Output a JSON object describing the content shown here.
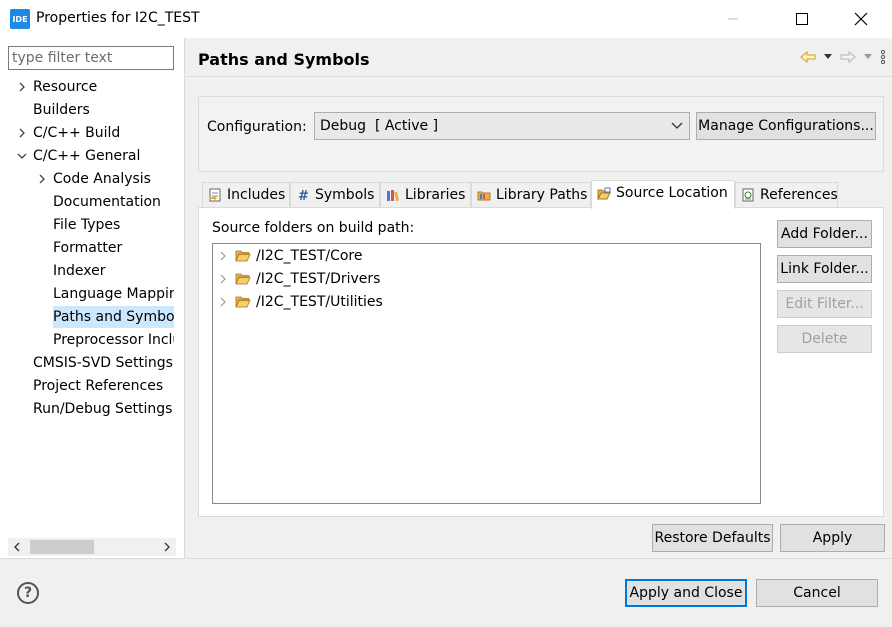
{
  "window": {
    "app_icon_text": "IDE",
    "title": "Properties for I2C_TEST"
  },
  "sidebar": {
    "filter_placeholder": "type filter text",
    "items": [
      {
        "label": "Resource",
        "expandable": true,
        "expanded": false,
        "level": 0
      },
      {
        "label": "Builders",
        "expandable": false,
        "level": 0
      },
      {
        "label": "C/C++ Build",
        "expandable": true,
        "expanded": false,
        "level": 0
      },
      {
        "label": "C/C++ General",
        "expandable": true,
        "expanded": true,
        "level": 0
      },
      {
        "label": "Code Analysis",
        "expandable": true,
        "expanded": false,
        "level": 1
      },
      {
        "label": "Documentation",
        "expandable": false,
        "level": 1
      },
      {
        "label": "File Types",
        "expandable": false,
        "level": 1
      },
      {
        "label": "Formatter",
        "expandable": false,
        "level": 1
      },
      {
        "label": "Indexer",
        "expandable": false,
        "level": 1
      },
      {
        "label": "Language Mappir",
        "expandable": false,
        "level": 1
      },
      {
        "label": "Paths and Symbol",
        "expandable": false,
        "level": 1,
        "selected": true
      },
      {
        "label": "Preprocessor Inclu",
        "expandable": false,
        "level": 1
      },
      {
        "label": "CMSIS-SVD Settings",
        "expandable": false,
        "level": 0
      },
      {
        "label": "Project References",
        "expandable": false,
        "level": 0
      },
      {
        "label": "Run/Debug Settings",
        "expandable": false,
        "level": 0
      }
    ]
  },
  "page": {
    "title": "Paths and Symbols",
    "configuration_label": "Configuration:",
    "configuration_value": "Debug  [ Active ]",
    "manage_configurations_label": "Manage Configurations...",
    "tabs": [
      {
        "label": "Includes",
        "icon": "includes-icon"
      },
      {
        "label": "Symbols",
        "icon": "hash-icon"
      },
      {
        "label": "Libraries",
        "icon": "libraries-icon"
      },
      {
        "label": "Library Paths",
        "icon": "library-paths-icon"
      },
      {
        "label": "Source Location",
        "icon": "source-folder-icon",
        "active": true
      },
      {
        "label": "References",
        "icon": "references-icon"
      }
    ],
    "source_folders_label": "Source folders on build path:",
    "folders": [
      "/I2C_TEST/Core",
      "/I2C_TEST/Drivers",
      "/I2C_TEST/Utilities"
    ],
    "side_buttons": {
      "add_folder": "Add Folder...",
      "link_folder": "Link Folder...",
      "edit_filter": "Edit Filter...",
      "delete": "Delete"
    },
    "restore_defaults_label": "Restore Defaults",
    "apply_label": "Apply"
  },
  "footer": {
    "help_symbol": "?",
    "apply_and_close_label": "Apply and Close",
    "cancel_label": "Cancel"
  },
  "colors": {
    "accent": "#0078d7",
    "selection": "#cce8ff",
    "folder": "#e8b04a"
  }
}
